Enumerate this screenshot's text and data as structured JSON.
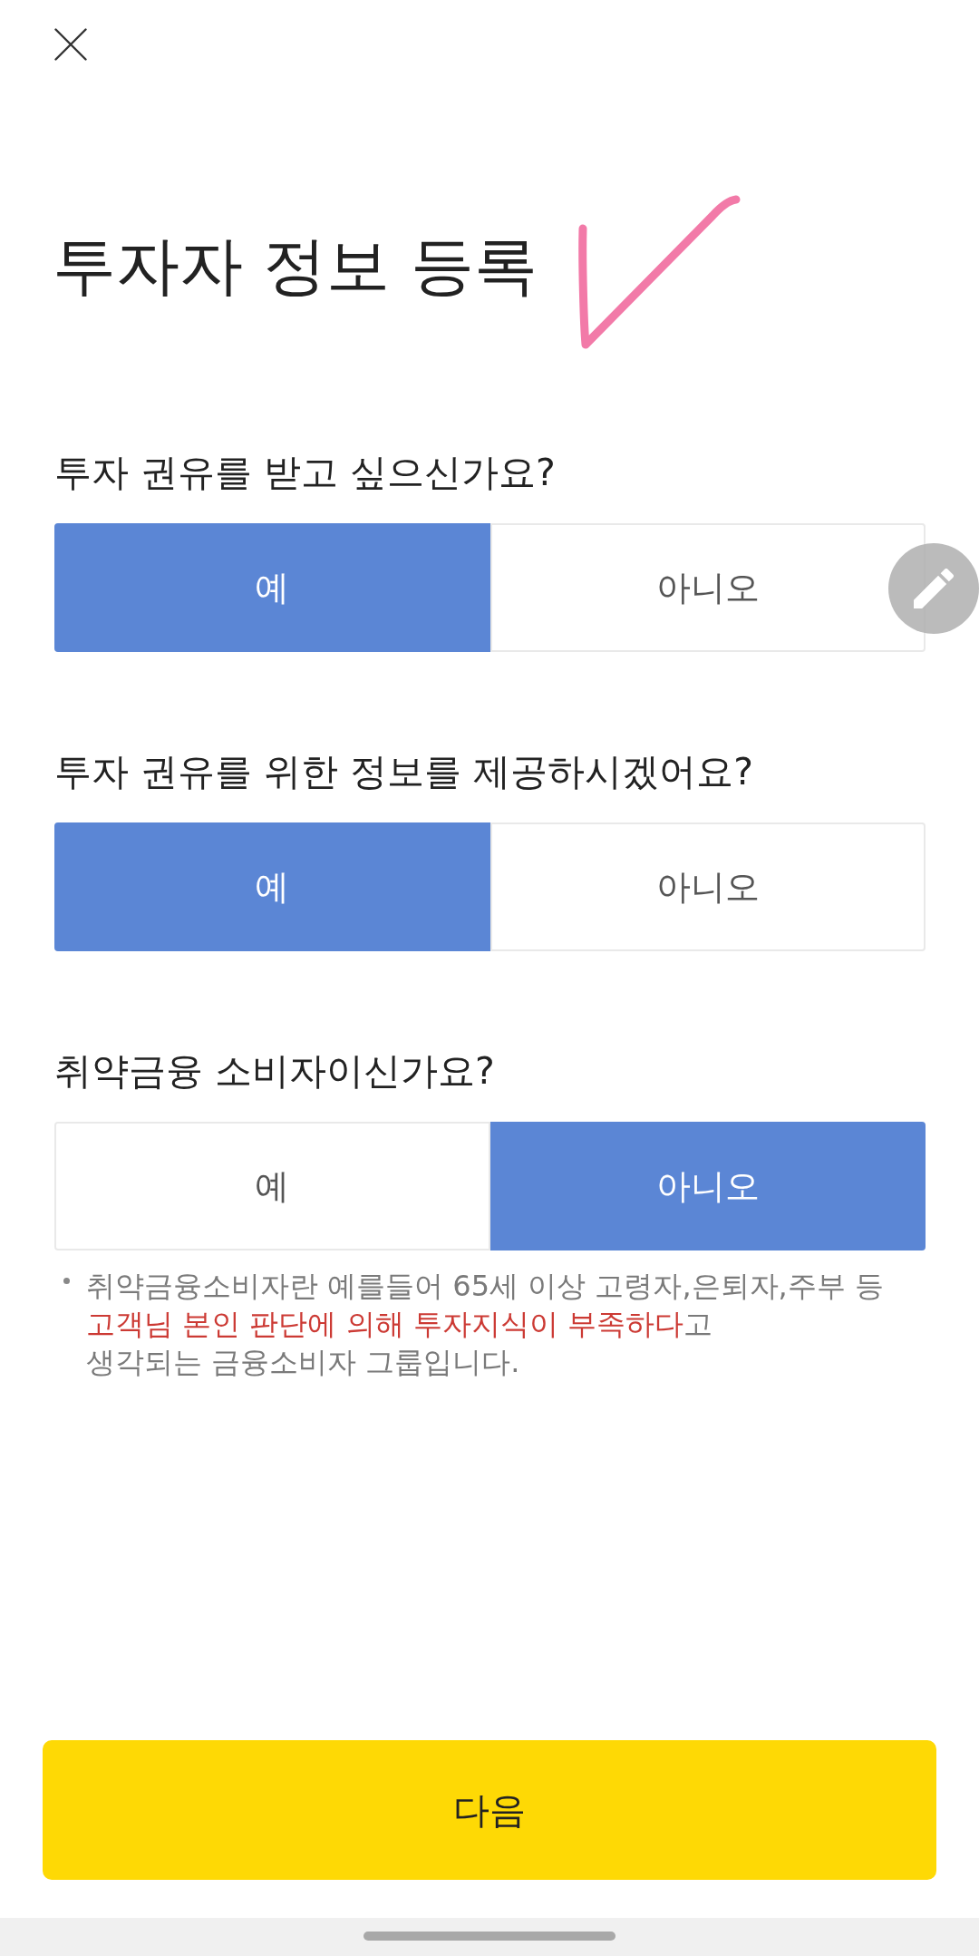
{
  "title": "투자자 정보 등록",
  "questions": [
    {
      "text": "투자 권유를 받고 싶으신가요?",
      "options": [
        {
          "label": "예",
          "selected": true
        },
        {
          "label": "아니오",
          "selected": false
        }
      ]
    },
    {
      "text": "투자 권유를 위한 정보를 제공하시겠어요?",
      "options": [
        {
          "label": "예",
          "selected": true
        },
        {
          "label": "아니오",
          "selected": false
        }
      ]
    },
    {
      "text": "취약금융 소비자이신가요?",
      "options": [
        {
          "label": "예",
          "selected": false
        },
        {
          "label": "아니오",
          "selected": true
        }
      ]
    }
  ],
  "note": "취약금융소비자란 예를들어 65세 이상 고령자,은퇴자,주부 등\n**고객님 본인 판단에 의해 투자지식이 부족하다**고\n생각되는 금융소비자 그룹입니다.",
  "next_button": "다음"
}
